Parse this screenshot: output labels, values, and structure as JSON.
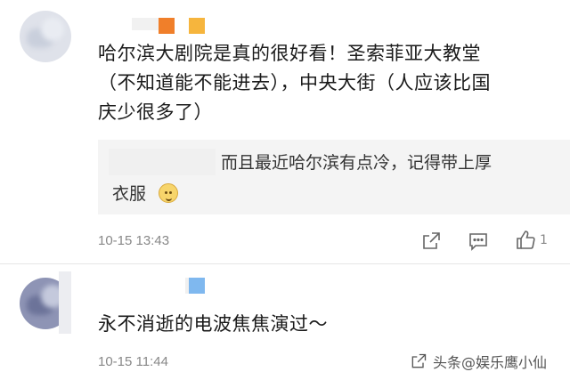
{
  "comments": [
    {
      "text_lines": [
        "哈尔滨大剧院是真的很好看！圣索菲亚大教堂",
        "（不知道能不能进去），中央大街（人应该比国",
        "庆少很多了）"
      ],
      "reply_lines": [
        "而且最近哈尔滨有点冷，记得带上厚",
        "衣服"
      ],
      "time": "10-15 13:43",
      "like_count": "1",
      "badge_colors": [
        "#f07f2a",
        "#f6b53d"
      ]
    },
    {
      "text_lines": [
        "永不消逝的电波焦焦演过～"
      ],
      "time": "10-15 11:44",
      "badge_colors": [
        "#7fb8ef"
      ]
    }
  ],
  "watermark": "头条@娱乐鹰小仙",
  "icons": {
    "share": "share-icon",
    "reply": "comment-icon",
    "like": "thumbs-up-icon"
  }
}
